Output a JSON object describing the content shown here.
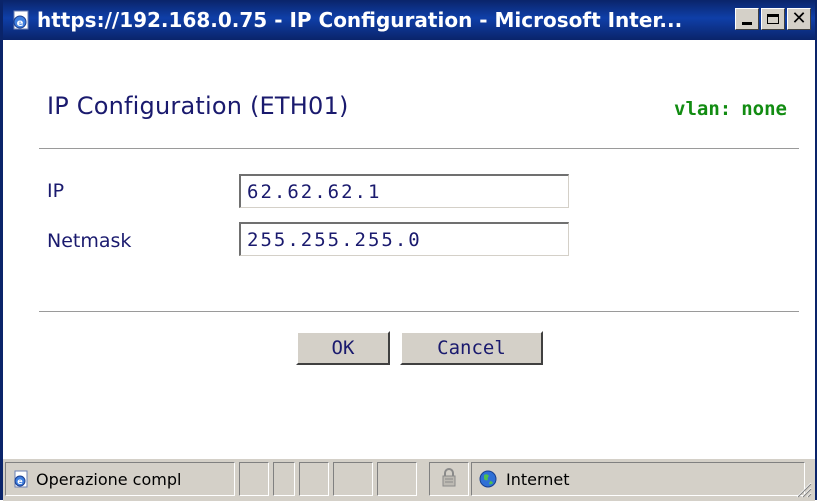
{
  "window": {
    "title": "https://192.168.0.75 - IP Configuration - Microsoft Inter...",
    "controls": {
      "minimize": "_",
      "maximize": "□",
      "close": "×"
    }
  },
  "header": {
    "title": "IP Configuration (ETH01)",
    "vlan_label": "vlan:",
    "vlan_value": "none"
  },
  "form": {
    "ip": {
      "label": "IP",
      "value": "62.62.62.1"
    },
    "netmask": {
      "label": "Netmask",
      "value": "255.255.255.0"
    }
  },
  "buttons": {
    "ok": "OK",
    "cancel": "Cancel"
  },
  "statusbar": {
    "status_text": "Operazione compl",
    "zone": "Internet"
  },
  "colors": {
    "titlebar": "#0a246a",
    "heading_text": "#1a1a6e",
    "vlan_text": "#128c12",
    "chrome": "#d4d0c8"
  },
  "icons": {
    "title": "ie-page-icon",
    "status_page": "ie-page-icon",
    "lock": "lock-icon",
    "zone": "globe-icon"
  }
}
